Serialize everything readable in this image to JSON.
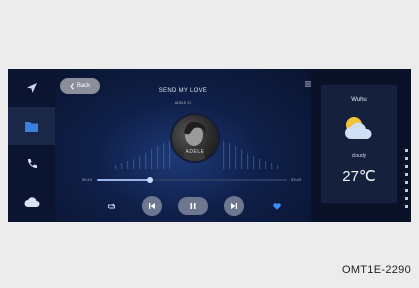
{
  "player": {
    "back_label": "Back",
    "title": "SEND MY LOVE",
    "artist": "ADELE 21",
    "album_text": "ADELE",
    "time_elapsed": "00:14",
    "time_total": "03:43",
    "progress": 0.28
  },
  "weather": {
    "city": "Wuhu",
    "condition": "cloudy",
    "temperature": "27℃"
  },
  "sidebar": {
    "items": [
      "navigation-icon",
      "media-icon",
      "phone-icon",
      "cloud-icon"
    ],
    "active_index": 1
  },
  "caption": "OMT1E-2290",
  "colors": {
    "screen_bg": "#0a1228",
    "accent": "#9ab3e6",
    "button_bg": "#6d7890",
    "favorite": "#3d8bff"
  }
}
